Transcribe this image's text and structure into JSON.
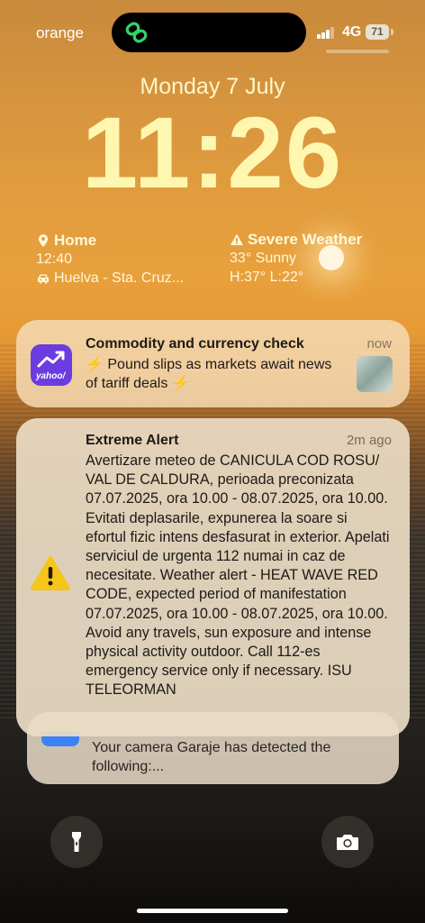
{
  "status": {
    "carrier": "orange",
    "network": "4G",
    "battery": "71"
  },
  "lockscreen": {
    "date": "Monday 7 July",
    "time": "11:26"
  },
  "widgets": {
    "home": {
      "title": "Home",
      "time": "12:40",
      "route": "Huelva - Sta. Cruz..."
    },
    "weather": {
      "title": "Severe Weather",
      "current": "33° Sunny",
      "range": "H:37° L:22°"
    }
  },
  "notifications": [
    {
      "app_icon": "yahoo-finance-icon",
      "app_icon_text": "yahoo/",
      "title": "Commodity and currency check",
      "time": "now",
      "body": "⚡️ Pound slips as markets await news of tariff deals ⚡️"
    },
    {
      "app_icon": "warning-icon",
      "title": "Extreme Alert",
      "time": "2m ago",
      "body": "Avertizare meteo de CANICULA COD ROSU/ VAL DE CALDURA, perioada preconizata 07.07.2025, ora 10.00 - 08.07.2025, ora 10.00. Evitati deplasarile, expunerea la soare si efortul fizic intens desfasurat in exterior. Apelati serviciul de urgenta 112 numai in caz de necesitate. Weather alert - HEAT WAVE RED CODE, expected period of manifestation 07.07.2025, ora 10.00 - 08.07.2025, ora 10.00. Avoid any travels, sun exposure and intense physical activity outdoor. Call 112-es emergency service only if necessary. ISU TELEORMAN"
    },
    {
      "app_icon": "camera-app-icon",
      "body": "Your camera Garaje has detected the following:..."
    }
  ],
  "quick_actions": {
    "left": "flashlight-icon",
    "right": "camera-icon"
  },
  "colors": {
    "clock": "#fff7b0",
    "yahoo_purple": "#6b3ce0",
    "warning_yellow": "#f5c518"
  }
}
